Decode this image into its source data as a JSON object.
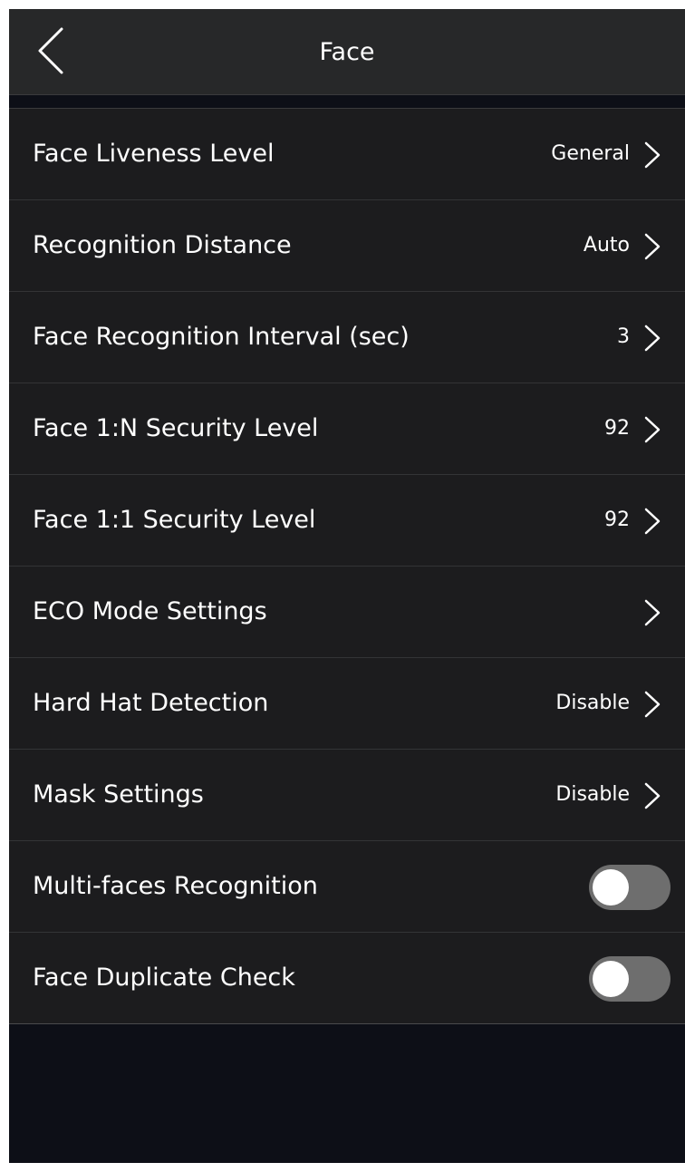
{
  "header": {
    "title": "Face",
    "back_icon": "chevron-left-icon"
  },
  "settings": [
    {
      "label": "Face Liveness Level",
      "value": "General",
      "control": "chevron"
    },
    {
      "label": "Recognition Distance",
      "value": "Auto",
      "control": "chevron"
    },
    {
      "label": "Face Recognition Interval (sec)",
      "value": "3",
      "control": "chevron"
    },
    {
      "label": "Face 1:N Security Level",
      "value": "92",
      "control": "chevron"
    },
    {
      "label": "Face 1:1 Security Level",
      "value": "92",
      "control": "chevron"
    },
    {
      "label": "ECO Mode Settings",
      "value": "",
      "control": "chevron"
    },
    {
      "label": "Hard Hat Detection",
      "value": "Disable",
      "control": "chevron"
    },
    {
      "label": "Mask Settings",
      "value": "Disable",
      "control": "chevron"
    },
    {
      "label": "Multi-faces Recognition",
      "control": "toggle",
      "enabled": false
    },
    {
      "label": "Face Duplicate Check",
      "control": "toggle",
      "enabled": false
    }
  ],
  "colors": {
    "background": "#0d0f17",
    "header": "#272829",
    "row": "#1c1c1e",
    "toggle_off": "#6e6e6e",
    "text": "#ffffff"
  }
}
